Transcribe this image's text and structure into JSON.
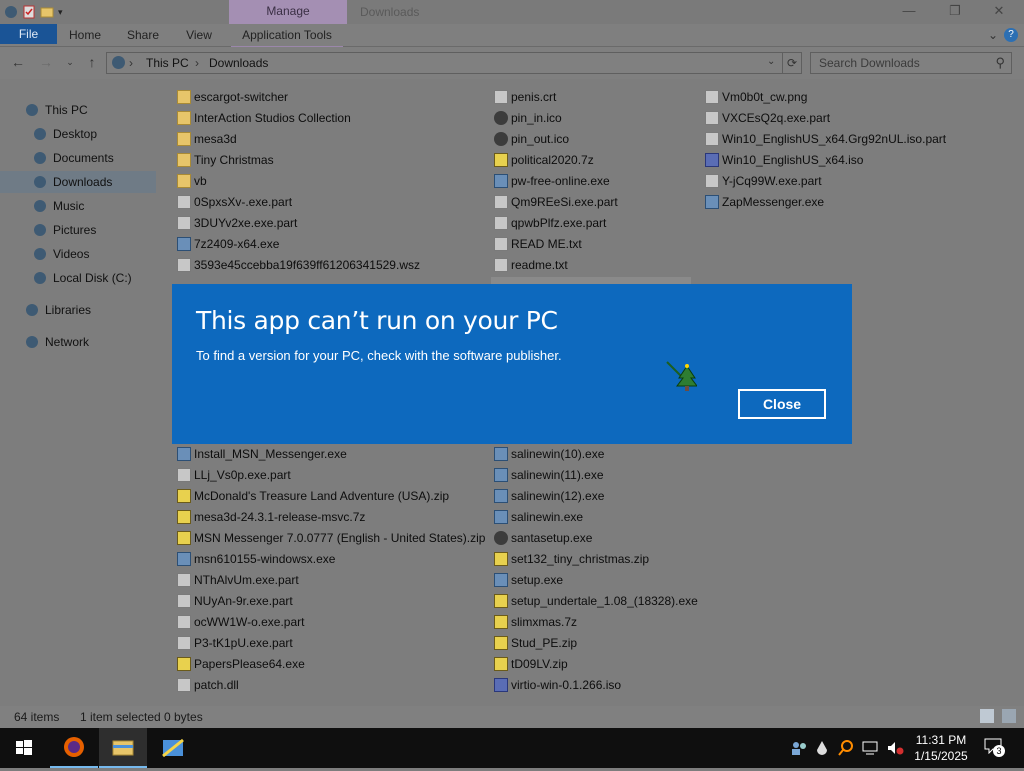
{
  "window": {
    "title": "Downloads",
    "manage_tab": "Manage",
    "controls": {
      "minimize": "—",
      "maximize": "❐",
      "close": "✕"
    }
  },
  "ribbon": {
    "tabs": [
      "File",
      "Home",
      "Share",
      "View",
      "Application Tools"
    ],
    "help": "?"
  },
  "address": {
    "crumbs": [
      "This PC",
      "Downloads"
    ],
    "search_placeholder": "Search Downloads"
  },
  "nav": {
    "items": [
      {
        "label": "This PC",
        "icon": "computer-icon"
      },
      {
        "label": "Desktop",
        "icon": "desktop-icon"
      },
      {
        "label": "Documents",
        "icon": "documents-icon"
      },
      {
        "label": "Downloads",
        "icon": "downloads-icon",
        "selected": true
      },
      {
        "label": "Music",
        "icon": "music-icon"
      },
      {
        "label": "Pictures",
        "icon": "pictures-icon"
      },
      {
        "label": "Videos",
        "icon": "videos-icon"
      },
      {
        "label": "Local Disk (C:)",
        "icon": "disk-icon"
      },
      {
        "label": "Libraries",
        "icon": "libraries-icon"
      },
      {
        "label": "Network",
        "icon": "network-icon"
      }
    ]
  },
  "files": {
    "col1_top": [
      {
        "name": "escargot-switcher",
        "icon": "folder"
      },
      {
        "name": "InterAction Studios Collection",
        "icon": "folder"
      },
      {
        "name": "mesa3d",
        "icon": "folder"
      },
      {
        "name": "Tiny Christmas",
        "icon": "folder"
      },
      {
        "name": "vb",
        "icon": "folder"
      },
      {
        "name": "0SpxsXv-.exe.part",
        "icon": "doc"
      },
      {
        "name": "3DUYv2xe.exe.part",
        "icon": "doc"
      },
      {
        "name": "7z2409-x64.exe",
        "icon": "exe"
      },
      {
        "name": "3593e45ccebba19f639ff61206341529.wsz",
        "icon": "doc"
      }
    ],
    "col2_top": [
      {
        "name": "penis.crt",
        "icon": "doc"
      },
      {
        "name": "pin_in.ico",
        "icon": "gear"
      },
      {
        "name": "pin_out.ico",
        "icon": "gear"
      },
      {
        "name": "political2020.7z",
        "icon": "zip"
      },
      {
        "name": "pw-free-online.exe",
        "icon": "exe"
      },
      {
        "name": "Qm9REeSi.exe.part",
        "icon": "doc"
      },
      {
        "name": "qpwbPlfz.exe.part",
        "icon": "doc"
      },
      {
        "name": "READ ME.txt",
        "icon": "doc"
      },
      {
        "name": "readme.txt",
        "icon": "doc"
      }
    ],
    "col3_top": [
      {
        "name": "Vm0b0t_cw.png",
        "icon": "doc"
      },
      {
        "name": "VXCEsQ2q.exe.part",
        "icon": "doc"
      },
      {
        "name": "Win10_EnglishUS_x64.Grg92nUL.iso.part",
        "icon": "doc"
      },
      {
        "name": "Win10_EnglishUS_x64.iso",
        "icon": "iso"
      },
      {
        "name": "Y-jCq99W.exe.part",
        "icon": "doc"
      },
      {
        "name": "ZapMessenger.exe",
        "icon": "exe"
      }
    ],
    "col1_bottom": [
      {
        "name": "Install_MSN_Messenger.exe",
        "icon": "exe"
      },
      {
        "name": "LLj_Vs0p.exe.part",
        "icon": "doc"
      },
      {
        "name": "McDonald's Treasure Land Adventure (USA).zip",
        "icon": "zip"
      },
      {
        "name": "mesa3d-24.3.1-release-msvc.7z",
        "icon": "zip"
      },
      {
        "name": "MSN Messenger 7.0.0777 (English - United States).zip",
        "icon": "zip"
      },
      {
        "name": "msn610155-windowsx.exe",
        "icon": "exe"
      },
      {
        "name": "NThAlvUm.exe.part",
        "icon": "doc"
      },
      {
        "name": "NUyAn-9r.exe.part",
        "icon": "doc"
      },
      {
        "name": "ocWW1W-o.exe.part",
        "icon": "doc"
      },
      {
        "name": "P3-tK1pU.exe.part",
        "icon": "doc"
      },
      {
        "name": "PapersPlease64.exe",
        "icon": "zip"
      },
      {
        "name": "patch.dll",
        "icon": "doc"
      }
    ],
    "col2_bottom": [
      {
        "name": "salinewin(10).exe",
        "icon": "exe"
      },
      {
        "name": "salinewin(11).exe",
        "icon": "exe"
      },
      {
        "name": "salinewin(12).exe",
        "icon": "exe"
      },
      {
        "name": "salinewin.exe",
        "icon": "exe"
      },
      {
        "name": "santasetup.exe",
        "icon": "gear"
      },
      {
        "name": "set132_tiny_christmas.zip",
        "icon": "zip"
      },
      {
        "name": "setup.exe",
        "icon": "exe"
      },
      {
        "name": "setup_undertale_1.08_(18328).exe",
        "icon": "zip"
      },
      {
        "name": "slimxmas.7z",
        "icon": "zip"
      },
      {
        "name": "Stud_PE.zip",
        "icon": "zip"
      },
      {
        "name": "tD09LV.zip",
        "icon": "zip"
      },
      {
        "name": "virtio-win-0.1.266.iso",
        "icon": "iso"
      }
    ]
  },
  "status": {
    "count": "64 items",
    "selection": "1 item selected",
    "size": "0 bytes"
  },
  "dialog": {
    "title": "This app can’t run on your PC",
    "message": "To find a version for your PC, check with the software publisher.",
    "close_label": "Close"
  },
  "taskbar": {
    "time": "11:31 PM",
    "date": "1/15/2025",
    "notification_count": "3"
  },
  "colors": {
    "dialog_blue": "#0d69be",
    "file_tab": "#1a5496",
    "manage_tab": "#a48fb3"
  }
}
